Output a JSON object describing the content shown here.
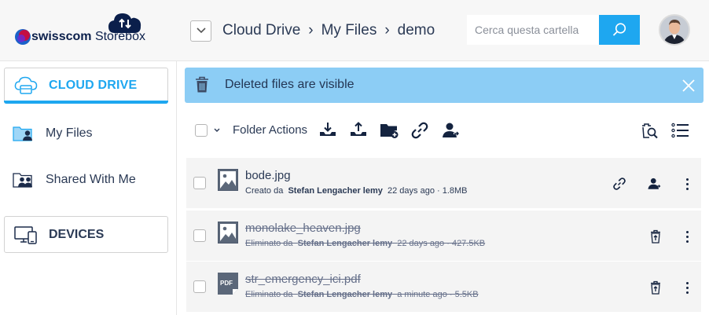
{
  "header": {
    "brand": "swisscom",
    "product": "Storebox",
    "breadcrumb": [
      "Cloud Drive",
      "My Files",
      "demo"
    ],
    "breadcrumb_sep": "›",
    "search_placeholder": "Cerca questa cartella"
  },
  "sidebar": {
    "cloud_drive": "CLOUD DRIVE",
    "my_files": "My Files",
    "shared_with_me": "Shared With Me",
    "devices": "DEVICES"
  },
  "banner": {
    "text": "Deleted files are visible"
  },
  "toolbar": {
    "folder_actions": "Folder Actions"
  },
  "files": [
    {
      "name": "bode.jpg",
      "meta_prefix": "Creato da",
      "owner": "Stefan Lengacher lemy",
      "meta_suffix": "22 days ago · 1.8MB",
      "deleted": false,
      "type": "image"
    },
    {
      "name": "monolake_heaven.jpg",
      "meta_prefix": "Eliminato da",
      "owner": "Stefan Lengacher lemy",
      "meta_suffix": "22 days ago · 427.5KB",
      "deleted": true,
      "type": "image"
    },
    {
      "name": "str_emergency_ici.pdf",
      "meta_prefix": "Eliminato da",
      "owner": "Stefan Lengacher lemy",
      "meta_suffix": "a minute ago · 5.5KB",
      "deleted": true,
      "type": "pdf",
      "type_label": "PDF"
    }
  ],
  "colors": {
    "accent": "#1ea7f0",
    "banner": "#8ccdf5",
    "text": "#2b3a55",
    "icon": "#14233f"
  }
}
